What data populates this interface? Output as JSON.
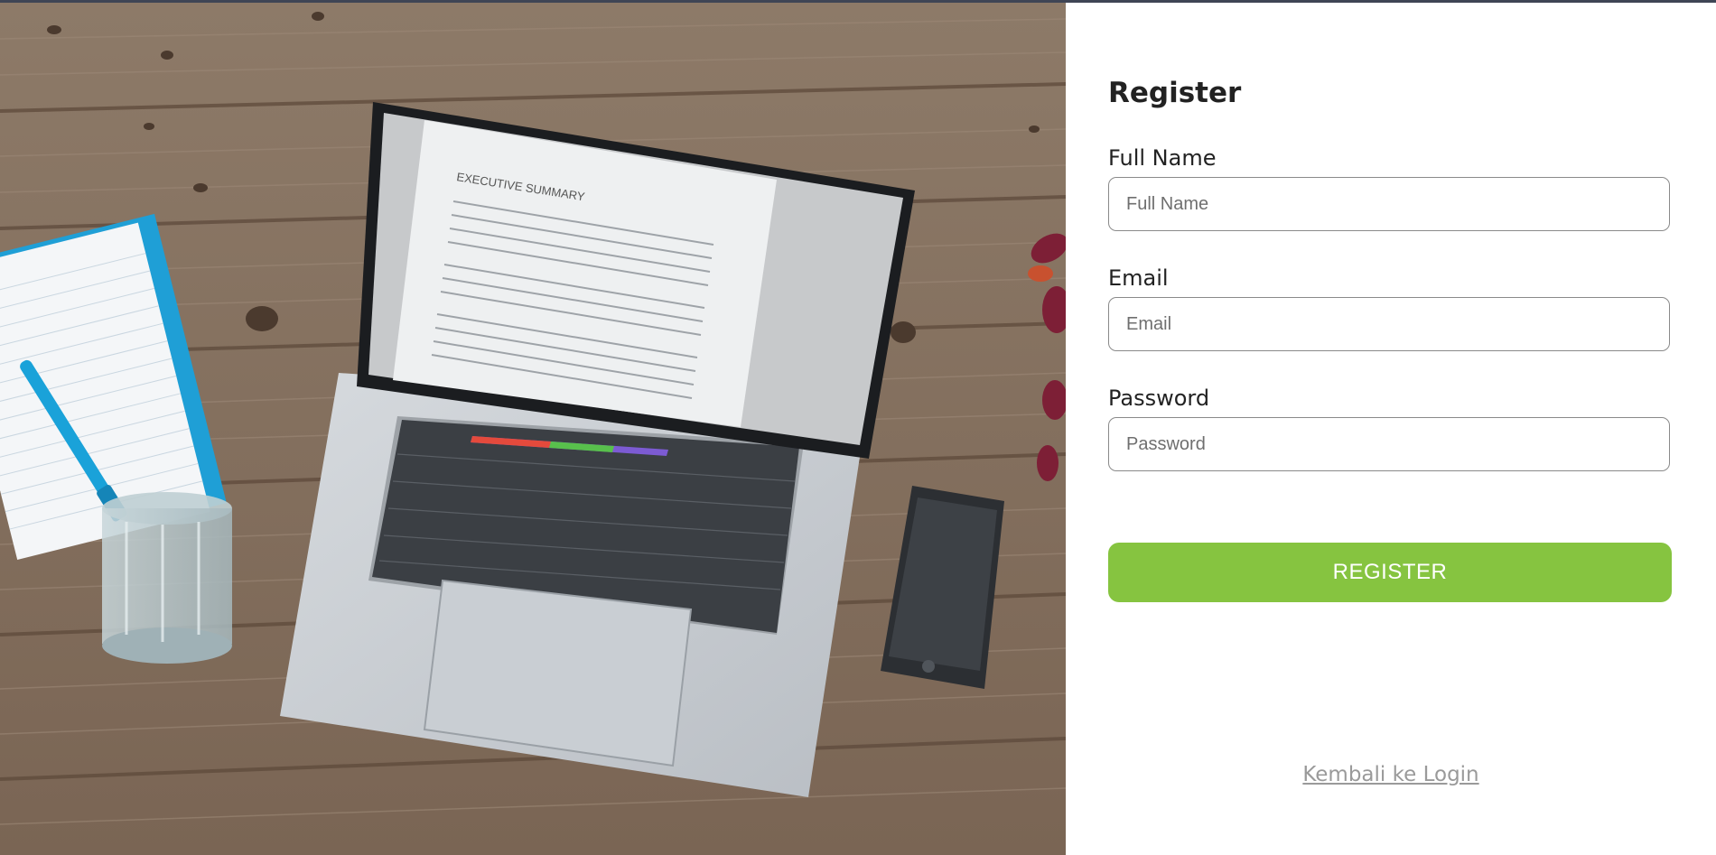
{
  "photo": {
    "alt": "",
    "screen_heading": "EXECUTIVE SUMMARY"
  },
  "form": {
    "title": "Register",
    "fields": [
      {
        "label": "Full Name",
        "placeholder": "Full Name",
        "value": ""
      },
      {
        "label": "Email",
        "placeholder": "Email",
        "value": ""
      },
      {
        "label": "Password",
        "placeholder": "Password",
        "value": ""
      }
    ],
    "submit_label": "REGISTER",
    "back_link": "Kembali ke Login"
  },
  "colors": {
    "accent": "#86c440",
    "link": "#9a9a9a",
    "topbar": "#3f4555"
  }
}
